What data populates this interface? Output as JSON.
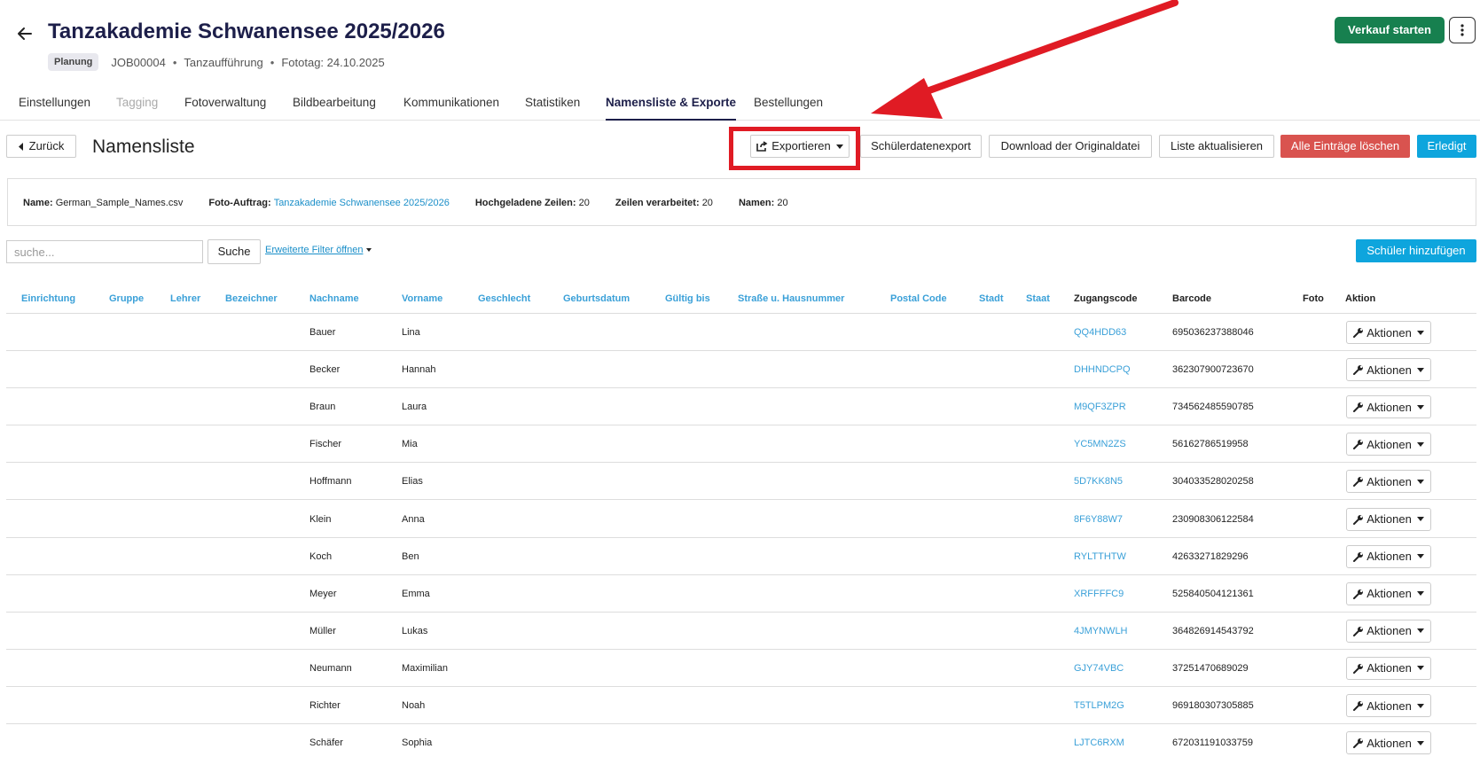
{
  "header": {
    "title": "Tanzakademie Schwanensee 2025/2026",
    "status_badge": "Planung",
    "job_id": "JOB00004",
    "job_type": "Tanzaufführung",
    "photo_day": "Fototag: 24.10.2025",
    "sale_button": "Verkauf starten"
  },
  "tabs": [
    {
      "label": "Einstellungen",
      "state": "normal"
    },
    {
      "label": "Tagging",
      "state": "disabled"
    },
    {
      "label": "Fotoverwaltung",
      "state": "normal"
    },
    {
      "label": "Bildbearbeitung",
      "state": "normal"
    },
    {
      "label": "Kommunikationen",
      "state": "normal"
    },
    {
      "label": "Statistiken",
      "state": "normal"
    },
    {
      "label": "Namensliste & Exporte",
      "state": "active"
    },
    {
      "label": "Bestellungen",
      "state": "normal"
    }
  ],
  "toolbar": {
    "back_label": "Zurück",
    "section_title": "Namensliste",
    "export_label": "Exportieren",
    "student_export_label": "Schülerdatenexport",
    "download_original_label": "Download der Originaldatei",
    "refresh_label": "Liste aktualisieren",
    "delete_all_label": "Alle Einträge löschen",
    "done_label": "Erledigt"
  },
  "info": {
    "name_label": "Name:",
    "name_value": "German_Sample_Names.csv",
    "job_label": "Foto-Auftrag:",
    "job_value": "Tanzakademie Schwanensee 2025/2026",
    "uploaded_label": "Hochgeladene Zeilen:",
    "uploaded_value": "20",
    "processed_label": "Zeilen verarbeitet:",
    "processed_value": "20",
    "names_label": "Namen:",
    "names_value": "20"
  },
  "search": {
    "placeholder": "suche...",
    "button_label": "Suche",
    "filter_link": "Erweiterte Filter öffnen",
    "add_student_label": "Schüler hinzufügen"
  },
  "table": {
    "columns": [
      "Einrichtung",
      "Gruppe",
      "Lehrer",
      "Bezeichner",
      "Nachname",
      "Vorname",
      "Geschlecht",
      "Geburtsdatum",
      "Gültig bis",
      "Straße u. Hausnummer",
      "Postal Code",
      "Stadt",
      "Staat",
      "Zugangscode",
      "Barcode",
      "Foto",
      "Aktion"
    ],
    "action_label": "Aktionen",
    "rows": [
      {
        "nachname": "Bauer",
        "vorname": "Lina",
        "code": "QQ4HDD63",
        "barcode": "695036237388046"
      },
      {
        "nachname": "Becker",
        "vorname": "Hannah",
        "code": "DHHNDCPQ",
        "barcode": "362307900723670"
      },
      {
        "nachname": "Braun",
        "vorname": "Laura",
        "code": "M9QF3ZPR",
        "barcode": "734562485590785"
      },
      {
        "nachname": "Fischer",
        "vorname": "Mia",
        "code": "YC5MN2ZS",
        "barcode": "56162786519958"
      },
      {
        "nachname": "Hoffmann",
        "vorname": "Elias",
        "code": "5D7KK8N5",
        "barcode": "304033528020258"
      },
      {
        "nachname": "Klein",
        "vorname": "Anna",
        "code": "8F6Y88W7",
        "barcode": "230908306122584"
      },
      {
        "nachname": "Koch",
        "vorname": "Ben",
        "code": "RYLTTHTW",
        "barcode": "42633271829296"
      },
      {
        "nachname": "Meyer",
        "vorname": "Emma",
        "code": "XRFFFFC9",
        "barcode": "525840504121361"
      },
      {
        "nachname": "Müller",
        "vorname": "Lukas",
        "code": "4JMYNWLH",
        "barcode": "364826914543792"
      },
      {
        "nachname": "Neumann",
        "vorname": "Maximilian",
        "code": "GJY74VBC",
        "barcode": "37251470689029"
      },
      {
        "nachname": "Richter",
        "vorname": "Noah",
        "code": "T5TLPM2G",
        "barcode": "969180307305885"
      },
      {
        "nachname": "Schäfer",
        "vorname": "Sophia",
        "code": "LJTC6RXM",
        "barcode": "672031191033759"
      }
    ]
  },
  "annotation": {
    "arrow_color": "#e01b24",
    "box_color": "#e01b24"
  }
}
